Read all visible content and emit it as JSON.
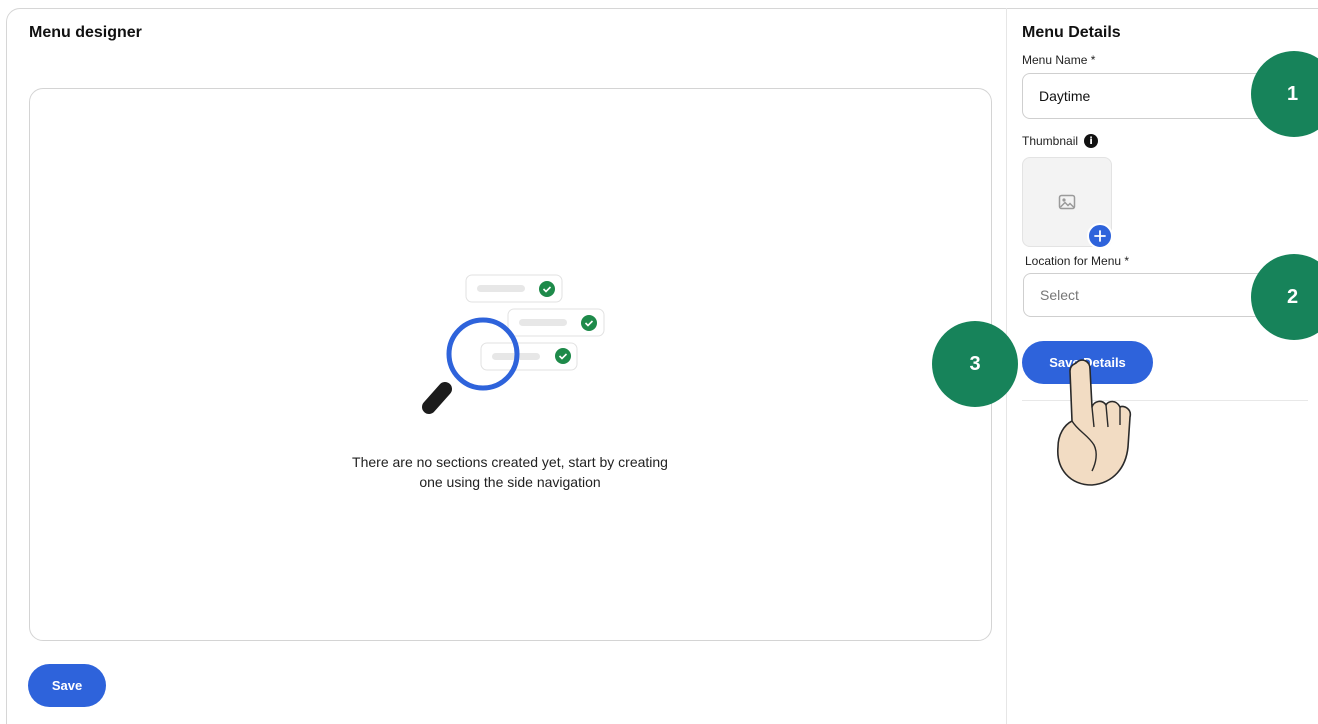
{
  "designer": {
    "title": "Menu designer",
    "empty_text_line1": "There are no sections created yet, start by creating",
    "empty_text_line2": "one using the side navigation",
    "save_label": "Save"
  },
  "details": {
    "title": "Menu Details",
    "menu_name_label": "Menu Name *",
    "menu_name_value": "Daytime",
    "thumbnail_label": "Thumbnail",
    "location_label": "Location for Menu *",
    "location_placeholder": "Select",
    "save_details_label": "Save Details"
  },
  "steps": [
    "1",
    "2",
    "3"
  ],
  "icons": {
    "info": "info-icon",
    "image": "image-placeholder-icon",
    "add": "plus-icon",
    "search": "magnifier-illustration",
    "check": "check-icon",
    "pointer": "pointing-hand-icon"
  },
  "colors": {
    "primary": "#2e63db",
    "step_badge": "#17835a",
    "check": "#1e8a4a"
  }
}
